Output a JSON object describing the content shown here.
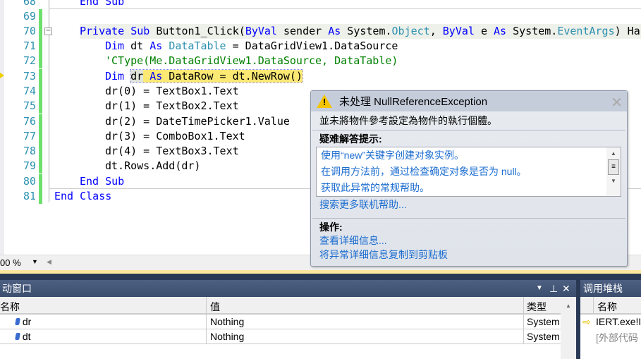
{
  "editor": {
    "lines": [
      {
        "n": "68",
        "code": "End Sub"
      },
      {
        "n": "69",
        "code": ""
      },
      {
        "n": "70",
        "code": "Private Sub Button1_Click(ByVal sender As System.Object, ByVal e As System.EventArgs) Han"
      },
      {
        "n": "71",
        "code": "Dim dt As DataTable = DataGridView1.DataSource"
      },
      {
        "n": "72",
        "code": "'CType(Me.DataGridView1.DataSource, DataTable)"
      },
      {
        "n": "73",
        "code": "Dim dr As DataRow = dt.NewRow()"
      },
      {
        "n": "74",
        "code": "dr(0) = TextBox1.Text"
      },
      {
        "n": "75",
        "code": "dr(1) = TextBox2.Text"
      },
      {
        "n": "76",
        "code": "dr(2) = DateTimePicker1.Value"
      },
      {
        "n": "77",
        "code": "dr(3) = ComboBox1.Text"
      },
      {
        "n": "78",
        "code": "dr(4) = TextBox3.Text"
      },
      {
        "n": "79",
        "code": "dt.Rows.Add(dr)"
      },
      {
        "n": "80",
        "code": "End Sub"
      },
      {
        "n": "81",
        "code": "End Class"
      }
    ],
    "zoom": "00 %"
  },
  "exception": {
    "title": "未处理 NullReferenceException",
    "message": "並未將物件參考設定為物件的執行個體。",
    "tips_heading": "疑难解答提示:",
    "tips": [
      "使用“new”关键字创建对象实例。",
      "在调用方法前，通过检查确定对象是否为 null。",
      "获取此异常的常规帮助。"
    ],
    "search_link": "搜索更多联机帮助...",
    "actions_heading": "操作:",
    "actions": [
      "查看详细信息...",
      "将异常详细信息复制到剪贴板"
    ]
  },
  "autos": {
    "title": "动窗口",
    "columns": [
      "名称",
      "值",
      "类型"
    ],
    "rows": [
      {
        "name": "dr",
        "value": "Nothing",
        "type": "System"
      },
      {
        "name": "dt",
        "value": "Nothing",
        "type": "System"
      }
    ]
  },
  "callstack": {
    "title": "调用堆栈",
    "column": "名称",
    "rows": [
      "IERT.exe!I",
      "[外部代码"
    ]
  }
}
